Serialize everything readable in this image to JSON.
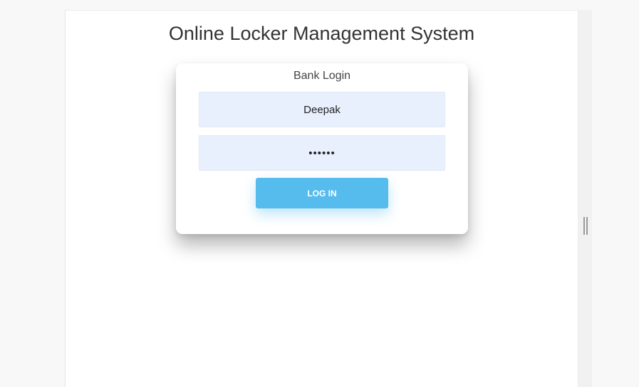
{
  "page": {
    "title": "Online Locker Management System"
  },
  "login": {
    "heading": "Bank Login",
    "username_value": "Deepak",
    "password_value": "••••••",
    "submit_label": "LOG IN"
  },
  "colors": {
    "input_background": "#e8f0fe",
    "button_background": "#56bbed",
    "button_text": "#ffffff",
    "title_text": "#333333"
  }
}
